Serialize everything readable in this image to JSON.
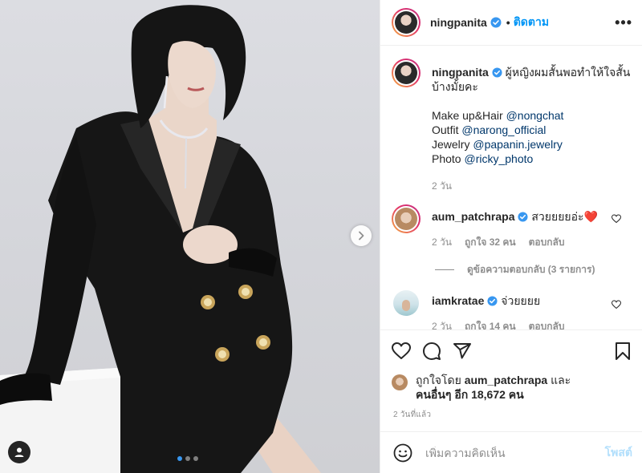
{
  "post": {
    "author": "ningpanita",
    "follow_label": "ติดตาม",
    "caption_line1": "ผู้หญิงผมสั้นพอทำให้ใจสั้น",
    "caption_line2": "บ้างมั้ยคะ",
    "credits": [
      {
        "label": "Make up&Hair",
        "mention": "@nongchat"
      },
      {
        "label": "Outfit",
        "mention": "@narong_official"
      },
      {
        "label": "Jewelry",
        "mention": "@papanin.jewelry"
      },
      {
        "label": "Photo",
        "mention": "@ricky_photo"
      }
    ],
    "caption_age": "2 วัน",
    "carousel": {
      "count": 3,
      "active_index": 0
    }
  },
  "comments": [
    {
      "user": "aum_patchrapa",
      "text": "สวยยยยอ่ะ❤️",
      "age": "2 วัน",
      "likes": "ถูกใจ 32 คน",
      "reply_label": "ตอบกลับ",
      "view_replies": "ดูข้อความตอบกลับ (3 รายการ)"
    },
    {
      "user": "iamkratae",
      "text": "จ่วยยยย",
      "age": "2 วัน",
      "likes": "ถูกใจ 14 คน",
      "reply_label": "ตอบกลับ"
    }
  ],
  "likes_summary": {
    "prefix": "ถูกใจโดย",
    "user": "aum_patchrapa",
    "and": "และ",
    "others": "คนอื่นๆ อีก 18,672 คน"
  },
  "post_time": "2 วันที่แล้ว",
  "add_comment": {
    "placeholder": "เพิ่มความคิดเห็น",
    "post_label": "โพสต์"
  },
  "colors": {
    "accent": "#0095f6",
    "verified": "#3897f0",
    "mention": "#00376b",
    "muted": "#8e8e8e",
    "heart_emoji": "#e0245e"
  },
  "icons": [
    "chevron-right-icon",
    "user-tag-icon",
    "verified-icon",
    "more-options-icon",
    "heart-icon",
    "comment-icon",
    "share-icon",
    "bookmark-icon",
    "emoji-icon"
  ]
}
